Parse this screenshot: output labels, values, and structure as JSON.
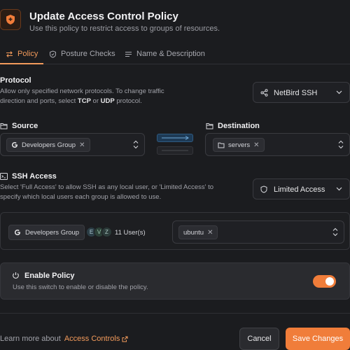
{
  "header": {
    "title": "Update Access Control Policy",
    "subtitle": "Use this policy to restrict access to groups of resources."
  },
  "tabs": [
    {
      "label": "Policy",
      "icon": "arrows-swap-icon",
      "active": true
    },
    {
      "label": "Posture Checks",
      "icon": "shield-check-icon",
      "active": false
    },
    {
      "label": "Name & Description",
      "icon": "list-icon",
      "active": false
    }
  ],
  "protocol": {
    "title": "Protocol",
    "desc_line1": "Allow only specified network protocols. To change traffic",
    "desc_line2_pre": "direction and ports, select ",
    "tcp": "TCP",
    "or": " or ",
    "udp": "UDP",
    "desc_line2_post": " protocol.",
    "selected": "NetBird SSH"
  },
  "source": {
    "title": "Source",
    "chip": "Developers Group"
  },
  "destination": {
    "title": "Destination",
    "chip": "servers"
  },
  "ssh": {
    "title": "SSH Access",
    "desc_line1": "Select 'Full Access' to allow SSH as any local user, or 'Limited Access' to",
    "desc_line2": "specify which local users each group is allowed to use.",
    "selected": "Limited Access",
    "group": "Developers Group",
    "avatars": [
      "E",
      "V",
      "Z"
    ],
    "users_count": "11 User(s)",
    "local_user": "ubuntu"
  },
  "enable": {
    "title": "Enable Policy",
    "desc": "Use this switch to enable or disable the policy.",
    "on": true
  },
  "footer": {
    "learn_prefix": "Learn more about",
    "learn_link": "Access Controls",
    "cancel": "Cancel",
    "save": "Save Changes"
  },
  "colors": {
    "accent": "#f07d3a",
    "background": "#1b1c1f"
  }
}
